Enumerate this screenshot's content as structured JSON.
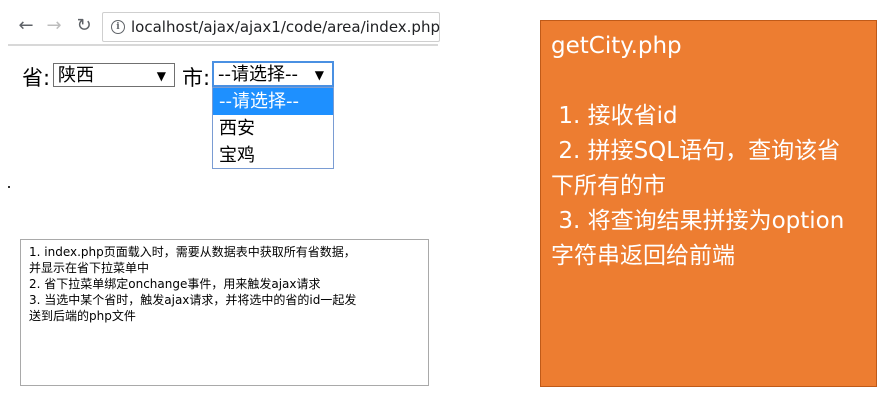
{
  "browser": {
    "url": "localhost/ajax/ajax1/code/area/index.php",
    "back_icon": "←",
    "forward_icon": "→",
    "reload_icon": "↻",
    "info_icon": "i"
  },
  "form": {
    "province_label": "省:",
    "province_value": "陕西",
    "city_label": "市:",
    "city_value": "--请选择--",
    "arrow": "▼",
    "city_options": [
      "--请选择--",
      "西安",
      "宝鸡"
    ]
  },
  "notes": [
    "1. index.php页面载入时，需要从数据表中获取所有省数据，",
    "并显示在省下拉菜单中",
    "2. 省下拉菜单绑定onchange事件，用来触发ajax请求",
    "3. 当选中某个省时，触发ajax请求，并将选中的省的id一起发",
    "送到后端的php文件"
  ],
  "panel": {
    "title": "getCity.php",
    "lines": [
      "",
      " 1. 接收省id",
      " 2. 拼接SQL语句，查询该省",
      "下所有的市",
      " 3. 将查询结果拼接为option",
      "字符串返回给前端"
    ]
  }
}
